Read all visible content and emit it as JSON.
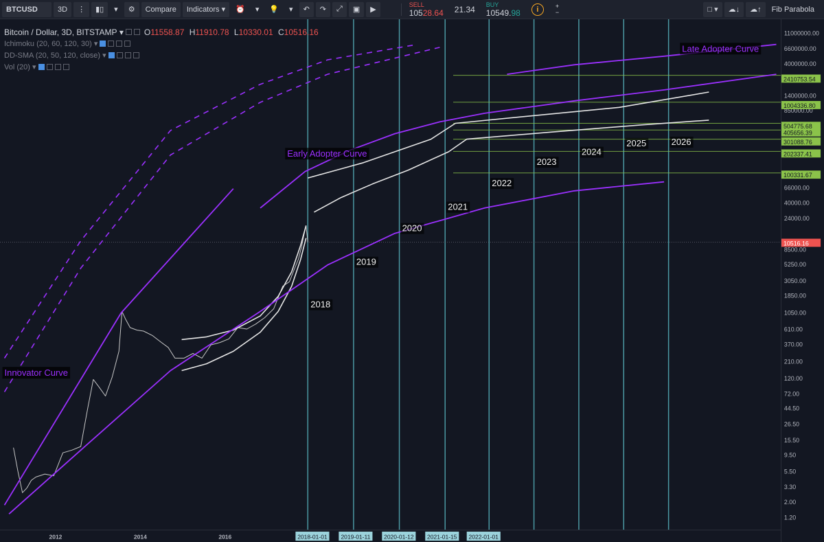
{
  "toolbar": {
    "symbol": "BTCUSD",
    "interval": "3D",
    "compare_label": "Compare",
    "indicators_label": "Indicators",
    "sell_label": "SELL",
    "sell_price_main": "105",
    "sell_price_hi": "28.64",
    "spread": "21.34",
    "buy_label": "BUY",
    "buy_price_main": "10549.",
    "buy_price_hi": "98",
    "tool_name": "Fib Parabola"
  },
  "legend": {
    "title": "Bitcoin / Dollar, 3D, BITSTAMP",
    "open_label": "O",
    "open": "11558.87",
    "high_label": "H",
    "high": "11910.78",
    "low_label": "L",
    "low": "10330.01",
    "close_label": "C",
    "close": "10516.16",
    "indicator_1": "Ichimoku (20, 60, 120, 30)",
    "indicator_2": "DD-SMA (20, 50, 120, close)",
    "indicator_3": "Vol (20)"
  },
  "colors": {
    "background": "#131722",
    "purple": "#9b30ff",
    "fib_white": "#e6e6e6",
    "vertical_line": "#5fc6cf",
    "horizontal_line": "#8bc34a",
    "price_tag_green": "#8bc34a",
    "price_tag_red": "#ef5350"
  },
  "chart_data": {
    "type": "line",
    "title": "Bitcoin / Dollar, 3D, BITSTAMP",
    "y_scale": "log",
    "ylim": [
      0.9,
      15000000
    ],
    "xlim": [
      2011.2,
      2028.6
    ],
    "grid": false,
    "price_axis_ticks": [
      11000000,
      6600000,
      4000000,
      1400000,
      850000,
      66000,
      40000,
      24000,
      8500,
      5250,
      3050,
      1850,
      1050,
      610,
      370,
      210,
      120,
      72,
      44.5,
      26.5,
      15.5,
      9.5,
      5.5,
      3.3,
      2,
      1.2
    ],
    "price_axis_labels": [
      "11000000.00",
      "6600000.00",
      "4000000.00",
      "1400000.00",
      "850000.00",
      "66000.00",
      "40000.00",
      "24000.00",
      "8500.00",
      "5250.00",
      "3050.00",
      "1850.00",
      "1050.00",
      "610.00",
      "370.00",
      "210.00",
      "120.00",
      "72.00",
      "44.50",
      "26.50",
      "15.50",
      "9.50",
      "5.50",
      "3.30",
      "2.00",
      "1.20"
    ],
    "time_axis_labels": [
      {
        "x": 2012,
        "label": "2012"
      },
      {
        "x": 2014,
        "label": "2014"
      },
      {
        "x": 2016,
        "label": "2016"
      }
    ],
    "current_price": {
      "value": 10516.16,
      "label": "10516.16"
    },
    "horizontal_levels": [
      {
        "value": 2410753.54,
        "label": "2410753.54"
      },
      {
        "value": 1004336.8,
        "label": "1004336.80"
      },
      {
        "value": 504775.68,
        "label": "504775.68"
      },
      {
        "value": 405656.39,
        "label": "405656.39"
      },
      {
        "value": 301088.76,
        "label": "301088.76"
      },
      {
        "value": 202337.41,
        "label": "202337.41"
      },
      {
        "value": 100331.67,
        "label": "100331.67"
      }
    ],
    "vertical_markers": [
      {
        "x": 2018.06,
        "date": "2018-01-01",
        "year_label": "2018",
        "label_y": 1250
      },
      {
        "x": 2019.08,
        "date": "2019-01-11",
        "year_label": "2019",
        "label_y": 5000
      },
      {
        "x": 2020.1,
        "date": "2020-01-12",
        "year_label": "2020",
        "label_y": 15000
      },
      {
        "x": 2021.12,
        "date": "2021-01-15",
        "year_label": "2021",
        "label_y": 30000
      },
      {
        "x": 2022.1,
        "date": "2022-01-01",
        "year_label": "2022",
        "label_y": 65000
      },
      {
        "x": 2023.1,
        "date": "",
        "year_label": "2023",
        "label_y": 130000
      },
      {
        "x": 2024.1,
        "date": "",
        "year_label": "2024",
        "label_y": 180000
      },
      {
        "x": 2025.1,
        "date": "",
        "year_label": "2025",
        "label_y": 240000
      },
      {
        "x": 2026.1,
        "date": "",
        "year_label": "2026",
        "label_y": 250000
      }
    ],
    "annotations": [
      {
        "text": "Innovator Curve",
        "x": 2011.3,
        "y": 135
      },
      {
        "text": "Early Adopter Curve",
        "x": 2017.6,
        "y": 170000
      },
      {
        "text": "Late Adopter Curve",
        "x": 2026.4,
        "y": 5200000
      }
    ],
    "series": [
      {
        "name": "",
        "role": "price",
        "x": [
          2011.5,
          2011.6,
          2011.7,
          2011.8,
          2011.9,
          2012.0,
          2012.2,
          2012.4,
          2012.6,
          2012.8,
          2013.0,
          2013.15,
          2013.28,
          2013.4,
          2013.55,
          2013.7,
          2013.85,
          2013.92,
          2014.0,
          2014.1,
          2014.25,
          2014.4,
          2014.6,
          2014.8,
          2014.95,
          2015.1,
          2015.3,
          2015.5,
          2015.7,
          2015.9,
          2016.1,
          2016.3,
          2016.5,
          2016.7,
          2016.9,
          2017.1,
          2017.3,
          2017.5,
          2017.65,
          2017.75,
          2017.85,
          2017.92,
          2017.97,
          2018.02,
          2018.06
        ],
        "values": [
          13,
          6,
          3,
          3.5,
          4.5,
          5,
          5.5,
          5.2,
          11,
          12,
          13.5,
          45,
          120,
          95,
          70,
          130,
          300,
          1100,
          850,
          650,
          600,
          580,
          500,
          400,
          340,
          240,
          240,
          280,
          240,
          370,
          400,
          450,
          650,
          620,
          730,
          900,
          1200,
          2500,
          2900,
          4200,
          6000,
          9000,
          13000,
          18000,
          10516
        ]
      },
      {
        "name": "",
        "role": "parabola_upper",
        "x": [
          2015.25,
          2015.8,
          2016.4,
          2017.0,
          2017.4,
          2017.7,
          2017.9,
          2018.02
        ],
        "values": [
          440,
          480,
          600,
          950,
          1800,
          4000,
          9500,
          18000
        ]
      },
      {
        "name": "",
        "role": "parabola_lower",
        "x": [
          2015.25,
          2015.8,
          2016.4,
          2017.0,
          2017.4,
          2017.7,
          2017.9,
          2018.02
        ],
        "values": [
          160,
          200,
          300,
          560,
          1100,
          2500,
          6000,
          12000
        ]
      },
      {
        "name": "",
        "role": "innovator_line",
        "x": [
          2011.3,
          2013.9,
          2016.4
        ],
        "values": [
          2,
          1050,
          60000
        ]
      },
      {
        "name": "",
        "role": "innovator_dashed_1",
        "x": [
          2011.3,
          2013.0,
          2015.0,
          2017.0,
          2018.5,
          2021.0
        ],
        "values": [
          80,
          4500,
          180000,
          1000000,
          2500000,
          6000000
        ]
      },
      {
        "name": "",
        "role": "innovator_dashed_2",
        "x": [
          2011.3,
          2013.0,
          2015.0,
          2017.0,
          2018.5,
          2020.5
        ],
        "values": [
          240,
          11000,
          400000,
          1800000,
          4000000,
          6600000
        ]
      },
      {
        "name": "",
        "role": "support_line",
        "x": [
          2011.4,
          2013.0,
          2015.0,
          2017.0,
          2018.5,
          2020.0,
          2022.0,
          2024.0,
          2026.0
        ],
        "values": [
          1.5,
          12,
          160,
          1100,
          5000,
          14000,
          32000,
          56000,
          75000
        ]
      },
      {
        "name": "",
        "role": "early_adopter",
        "x": [
          2017.0,
          2018.0,
          2019.0,
          2020.0,
          2021.0,
          2022.0,
          2024.0,
          2026.0,
          2028.5
        ],
        "values": [
          32000,
          105000,
          210000,
          360000,
          530000,
          700000,
          1050000,
          1500000,
          2500000
        ]
      },
      {
        "name": "",
        "role": "late_adopter",
        "x": [
          2022.5,
          2024.0,
          2026.0,
          2028.5
        ],
        "values": [
          2500000,
          3400000,
          4500000,
          6600000
        ]
      },
      {
        "name": "",
        "role": "fib_white_1",
        "x": [
          2018.06,
          2018.7,
          2019.3,
          2020.0,
          2020.8,
          2021.35,
          2023.0,
          2025.0,
          2027.0
        ],
        "values": [
          85000,
          110000,
          140000,
          200000,
          300000,
          504775,
          640000,
          850000,
          1400000
        ]
      },
      {
        "name": "",
        "role": "fib_white_2",
        "x": [
          2018.2,
          2018.8,
          2019.5,
          2020.3,
          2021.2,
          2021.6,
          2023.5,
          2025.5,
          2027.0
        ],
        "values": [
          28000,
          45000,
          70000,
          110000,
          200000,
          301088,
          380000,
          480000,
          560000
        ]
      }
    ]
  }
}
